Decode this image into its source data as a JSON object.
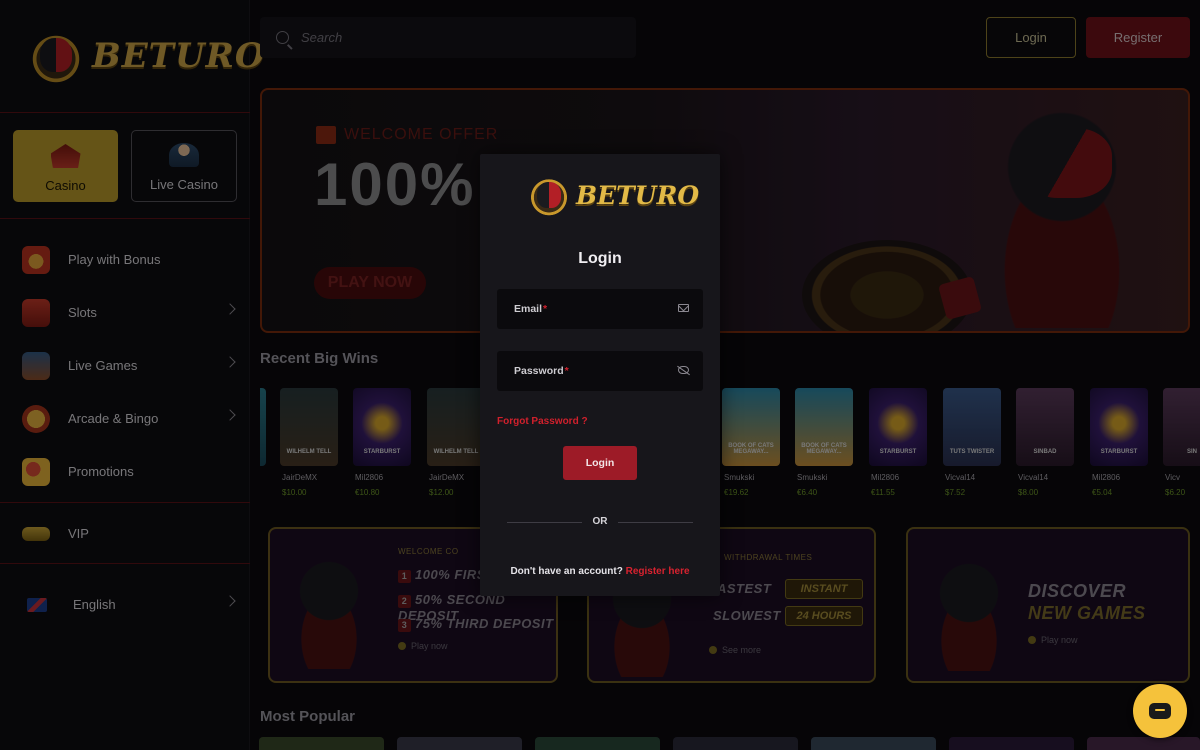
{
  "brand": {
    "name": "BETURO"
  },
  "search": {
    "placeholder": "Search"
  },
  "header": {
    "login_label": "Login",
    "register_label": "Register"
  },
  "sidebar": {
    "tabs": [
      {
        "label": "Casino",
        "active": true
      },
      {
        "label": "Live Casino",
        "active": false
      }
    ],
    "items": [
      {
        "label": "Play with Bonus",
        "icon": "gift-icon",
        "chevron": false
      },
      {
        "label": "Slots",
        "icon": "slot-machine-icon",
        "chevron": true
      },
      {
        "label": "Live Games",
        "icon": "live-dealer-icon",
        "chevron": true
      },
      {
        "label": "Arcade & Bingo",
        "icon": "bingo-ball-icon",
        "chevron": true
      },
      {
        "label": "Promotions",
        "icon": "promotions-icon",
        "chevron": false
      },
      {
        "label": "VIP",
        "icon": "vip-card-icon",
        "chevron": false
      },
      {
        "label": "English",
        "icon": "uk-flag-icon",
        "chevron": true
      }
    ]
  },
  "hero": {
    "eyebrow": "WELCOME OFFER",
    "headline": "100% C",
    "cta": "PLAY NOW"
  },
  "recent_wins": {
    "title": "Recent Big Wins",
    "items": [
      {
        "game": "",
        "user": "",
        "amount": ""
      },
      {
        "game": "WILHELM TELL",
        "user": "JairDeMX",
        "amount": "$10.00"
      },
      {
        "game": "STARBURST",
        "user": "Mil2806",
        "amount": "€10.80"
      },
      {
        "game": "WILHELM TELL",
        "user": "JairDeMX",
        "amount": "$12.00"
      },
      {
        "game": "BOOK OF CATS MEGAWAY...",
        "user": "Smukski",
        "amount": "€19.62"
      },
      {
        "game": "BOOK OF CATS MEGAWAY...",
        "user": "Smukski",
        "amount": "€6.40"
      },
      {
        "game": "STARBURST",
        "user": "Mil2806",
        "amount": "€11.55"
      },
      {
        "game": "TUTS TWISTER",
        "user": "Vicval14",
        "amount": "$7.52"
      },
      {
        "game": "SINBAD",
        "user": "Vicval14",
        "amount": "$8.00"
      },
      {
        "game": "STARBURST",
        "user": "Mil2806",
        "amount": "€5.04"
      },
      {
        "game": "SIN",
        "user": "Vicv",
        "amount": "$6.20"
      }
    ]
  },
  "promos": [
    {
      "eyebrow": "WELCOME CO",
      "lines": [
        {
          "num": "1",
          "text": "100% FIRS"
        },
        {
          "num": "2",
          "text": "50% SECOND DEPOSIT"
        },
        {
          "num": "3",
          "text": "75% THIRD DEPOSIT"
        }
      ],
      "link": "Play now"
    },
    {
      "eyebrow": "WITHDRAWAL TIMES",
      "rows": [
        {
          "label": "ASTEST",
          "value": "INSTANT"
        },
        {
          "label": "SLOWEST",
          "value": "24 HOURS"
        }
      ],
      "link": "See more"
    },
    {
      "title_line1": "DISCOVER",
      "title_line2": "NEW GAMES",
      "link": "Play now"
    }
  ],
  "most_popular": {
    "title": "Most Popular"
  },
  "login_modal": {
    "title": "Login",
    "email_label": "Email",
    "password_label": "Password",
    "required_mark": "*",
    "forgot": "Forgot Password ?",
    "submit": "Login",
    "or": "OR",
    "signup_prompt": "Don't have an account?",
    "signup_link": "Register here"
  },
  "chat": {
    "icon": "chat-icon"
  }
}
